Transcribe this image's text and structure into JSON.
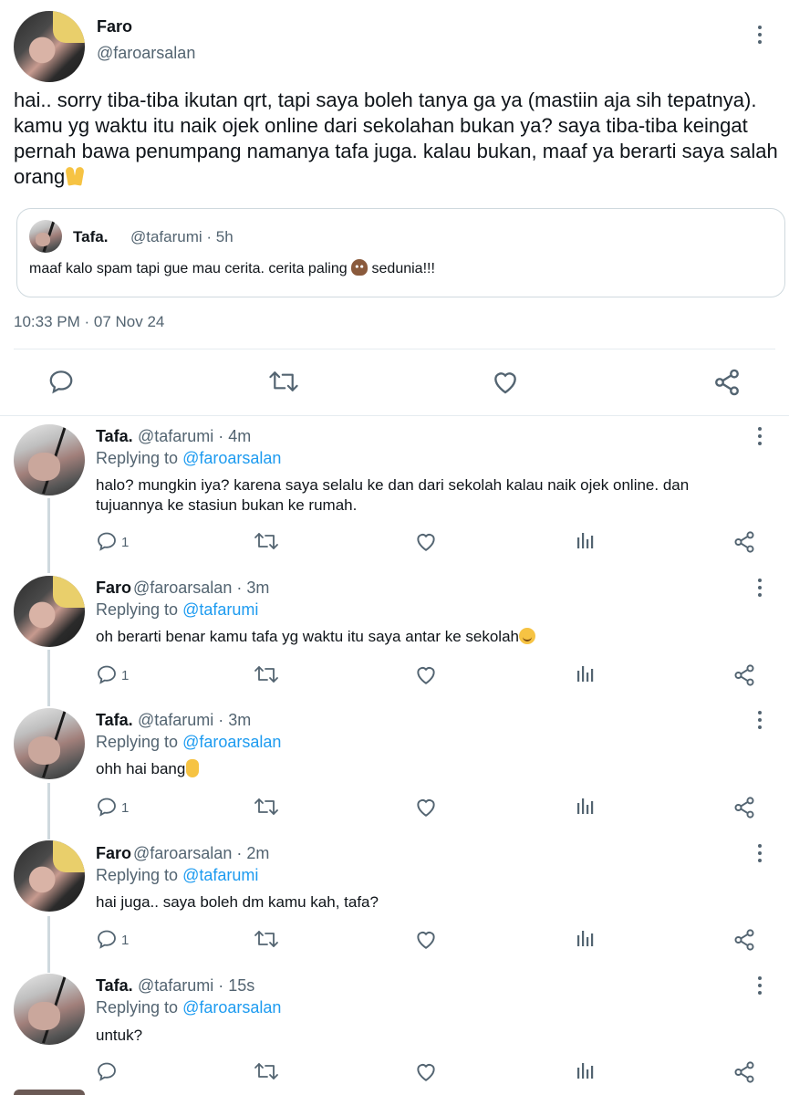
{
  "main_tweet": {
    "author_name": "Faro",
    "author_handle": "@faroarsalan",
    "text": "hai.. sorry tiba-tiba ikutan qrt, tapi saya boleh tanya ga ya (mastiin aja sih tepatnya). kamu yg waktu itu naik ojek online dari sekolahan bukan ya? saya tiba-tiba keingat pernah bawa penumpang namanya tafa juga. kalau bukan, maaf ya berarti saya salah orang",
    "emoji": "folded-hands",
    "timestamp": "10:33 PM · 07 Nov 24",
    "quote": {
      "name": "Tafa.",
      "handle_time": "@tafarumi · 5h",
      "text_before": "maaf kalo spam tapi gue mau cerita. cerita paling",
      "emoji": "pile-of-poo",
      "text_after": "sedunia!!!"
    },
    "actions": [
      "reply-icon",
      "retweet-icon",
      "like-icon",
      "share-icon"
    ]
  },
  "replies": [
    {
      "name": "Tafa.",
      "handle_time": "@tafarumi · 4m",
      "replying_label": "Replying to",
      "replying_to": "@faroarsalan",
      "text": "halo? mungkin iya? karena saya selalu ke dan dari sekolah kalau naik ojek online. dan tujuannya ke stasiun bukan ke rumah.",
      "reply_count": "1"
    },
    {
      "name": "Faro",
      "handle_time": "@faroarsalan · 3m",
      "replying_label": "Replying to",
      "replying_to": "@tafarumi",
      "text": "oh berarti benar kamu tafa yg waktu itu saya antar ke sekolah",
      "emoji": "smiling-face-with-sweat",
      "reply_count": "1"
    },
    {
      "name": "Tafa.",
      "handle_time": "@tafarumi · 3m",
      "replying_label": "Replying to",
      "replying_to": "@faroarsalan",
      "text": "ohh hai bang",
      "emoji": "raised-hand",
      "reply_count": "1"
    },
    {
      "name": "Faro",
      "handle_time": "@faroarsalan · 2m",
      "replying_label": "Replying to",
      "replying_to": "@tafarumi",
      "text": "hai juga.. saya boleh dm kamu kah, tafa?",
      "reply_count": "1"
    },
    {
      "name": "Tafa.",
      "handle_time": "@tafarumi · 15s",
      "replying_label": "Replying to",
      "replying_to": "@faroarsalan",
      "text": "untuk?",
      "reply_count": ""
    }
  ],
  "colors": {
    "text": "#0f1419",
    "secondary": "#536471",
    "link": "#1d9bf0",
    "border": "#cfd9de"
  }
}
